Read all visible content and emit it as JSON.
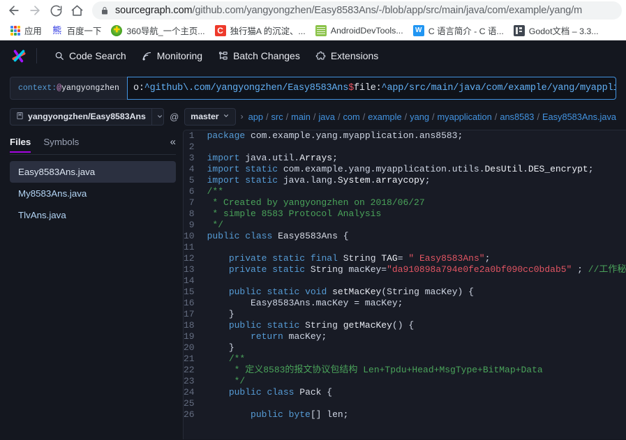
{
  "browser": {
    "nav": {
      "back_label": "Back",
      "forward_label": "Forward",
      "reload_label": "Reload",
      "home_label": "Home"
    },
    "omnibox": {
      "lock_icon": "lock-icon",
      "host": "sourcegraph.com",
      "path": "/github.com/yangyongzhen/Easy8583Ans/-/blob/app/src/main/java/com/example/yang/m"
    },
    "bookmarks": [
      {
        "label": "应用",
        "icon": "apps-grid-icon"
      },
      {
        "label": "百度一下",
        "icon": "baidu-icon"
      },
      {
        "label": "360导航_一个主页...",
        "icon": "360-nav-icon"
      },
      {
        "label": "独行猫A 的沉淀、...",
        "icon": "csdn-icon"
      },
      {
        "label": "AndroidDevTools...",
        "icon": "android-dev-tools-icon"
      },
      {
        "label": "C 语言简介 - C 语...",
        "icon": "w3c-icon"
      },
      {
        "label": "Godot文档 – 3.3...",
        "icon": "godot-icon"
      }
    ]
  },
  "sourcegraph": {
    "logo_icon": "sourcegraph-logo-icon",
    "nav_items": [
      {
        "label": "Code Search",
        "icon": "search-icon"
      },
      {
        "label": "Monitoring",
        "icon": "monitoring-icon"
      },
      {
        "label": "Batch Changes",
        "icon": "batch-changes-icon"
      },
      {
        "label": "Extensions",
        "icon": "puzzle-icon"
      }
    ],
    "search": {
      "context_prefix": "context:",
      "context_at": "@",
      "context_value": "yangyongzhen",
      "query_parts": [
        {
          "text": "o:",
          "color": "white"
        },
        {
          "text": "^github\\.com/yangyongzhen/Easy8583Ans",
          "color": "blue"
        },
        {
          "text": "$",
          "color": "red"
        },
        {
          "text": " file:",
          "color": "white"
        },
        {
          "text": "^app/src/main/java/com/example/yang/myapplicati",
          "color": "blue"
        }
      ]
    },
    "breadcrumb": {
      "repo_icon": "repository-icon",
      "repo": "yangyongzhen/Easy8583Ans",
      "repo_caret_icon": "chevron-down-icon",
      "at": "@",
      "revision": "master",
      "revision_caret_icon": "chevron-down-icon",
      "lead_chevron": "›",
      "path_parts": [
        "app",
        "src",
        "main",
        "java",
        "com",
        "example",
        "yang",
        "myapplication",
        "ans8583",
        "Easy8583Ans.java"
      ]
    },
    "sidebar": {
      "tabs": [
        {
          "label": "Files",
          "active": true
        },
        {
          "label": "Symbols",
          "active": false
        }
      ],
      "collapse_icon": "chevron-double-left-icon",
      "collapse_glyph": "«",
      "files": [
        {
          "name": "Easy8583Ans.java",
          "active": true
        },
        {
          "name": "My8583Ans.java",
          "active": false
        },
        {
          "name": "TlvAns.java",
          "active": false
        }
      ]
    },
    "code": {
      "language": "java",
      "lines": [
        {
          "n": 1,
          "tokens": [
            {
              "t": "package",
              "c": "kw"
            },
            {
              "t": " com.example.yang.myapplication.ans8583;",
              "c": "plain"
            }
          ]
        },
        {
          "n": 2,
          "tokens": []
        },
        {
          "n": 3,
          "tokens": [
            {
              "t": "import",
              "c": "kw"
            },
            {
              "t": " java.util.",
              "c": "plain"
            },
            {
              "t": "Arrays",
              "c": "prop"
            },
            {
              "t": ";",
              "c": "plain"
            }
          ]
        },
        {
          "n": 4,
          "tokens": [
            {
              "t": "import",
              "c": "kw"
            },
            {
              "t": " ",
              "c": "plain"
            },
            {
              "t": "static",
              "c": "kw"
            },
            {
              "t": " com.example.yang.myapplication.utils.",
              "c": "plain"
            },
            {
              "t": "DesUtil",
              "c": "prop"
            },
            {
              "t": ".",
              "c": "plain"
            },
            {
              "t": "DES_encrypt",
              "c": "prop"
            },
            {
              "t": ";",
              "c": "plain"
            }
          ]
        },
        {
          "n": 5,
          "tokens": [
            {
              "t": "import",
              "c": "kw"
            },
            {
              "t": " ",
              "c": "plain"
            },
            {
              "t": "static",
              "c": "kw"
            },
            {
              "t": " java.lang.",
              "c": "plain"
            },
            {
              "t": "System",
              "c": "prop"
            },
            {
              "t": ".",
              "c": "plain"
            },
            {
              "t": "arraycopy",
              "c": "prop"
            },
            {
              "t": ";",
              "c": "plain"
            }
          ]
        },
        {
          "n": 6,
          "tokens": [
            {
              "t": "/**",
              "c": "cmt"
            }
          ]
        },
        {
          "n": 7,
          "tokens": [
            {
              "t": " * Created by yangyongzhen on 2018/06/27",
              "c": "cmt"
            }
          ]
        },
        {
          "n": 8,
          "tokens": [
            {
              "t": " * simple 8583 Protocol Analysis",
              "c": "cmt"
            }
          ]
        },
        {
          "n": 9,
          "tokens": [
            {
              "t": " */",
              "c": "cmt"
            }
          ]
        },
        {
          "n": 10,
          "tokens": [
            {
              "t": "public",
              "c": "kw"
            },
            {
              "t": " ",
              "c": "plain"
            },
            {
              "t": "class",
              "c": "kw"
            },
            {
              "t": " ",
              "c": "plain"
            },
            {
              "t": "Easy8583Ans",
              "c": "type"
            },
            {
              "t": " {",
              "c": "plain"
            }
          ]
        },
        {
          "n": 11,
          "tokens": []
        },
        {
          "n": 12,
          "tokens": [
            {
              "t": "    ",
              "c": "plain"
            },
            {
              "t": "private",
              "c": "kw"
            },
            {
              "t": " ",
              "c": "plain"
            },
            {
              "t": "static",
              "c": "kw"
            },
            {
              "t": " ",
              "c": "plain"
            },
            {
              "t": "final",
              "c": "kw"
            },
            {
              "t": " ",
              "c": "plain"
            },
            {
              "t": "String",
              "c": "type"
            },
            {
              "t": " ",
              "c": "plain"
            },
            {
              "t": "TAG",
              "c": "prop"
            },
            {
              "t": "= ",
              "c": "plain"
            },
            {
              "t": "\" Easy8583Ans\"",
              "c": "str"
            },
            {
              "t": ";",
              "c": "plain"
            }
          ]
        },
        {
          "n": 13,
          "tokens": [
            {
              "t": "    ",
              "c": "plain"
            },
            {
              "t": "private",
              "c": "kw"
            },
            {
              "t": " ",
              "c": "plain"
            },
            {
              "t": "static",
              "c": "kw"
            },
            {
              "t": " ",
              "c": "plain"
            },
            {
              "t": "String",
              "c": "type"
            },
            {
              "t": " macKey=",
              "c": "plain"
            },
            {
              "t": "\"da910898a794e0fe2a0bf090cc0bdab5\"",
              "c": "str"
            },
            {
              "t": " ; ",
              "c": "plain"
            },
            {
              "t": "//工作秘钥",
              "c": "cmt"
            }
          ]
        },
        {
          "n": 14,
          "tokens": []
        },
        {
          "n": 15,
          "tokens": [
            {
              "t": "    ",
              "c": "plain"
            },
            {
              "t": "public",
              "c": "kw"
            },
            {
              "t": " ",
              "c": "plain"
            },
            {
              "t": "static",
              "c": "kw"
            },
            {
              "t": " ",
              "c": "plain"
            },
            {
              "t": "void",
              "c": "kw"
            },
            {
              "t": " ",
              "c": "plain"
            },
            {
              "t": "setMacKey",
              "c": "fn"
            },
            {
              "t": "(",
              "c": "plain"
            },
            {
              "t": "String",
              "c": "type"
            },
            {
              "t": " macKey) {",
              "c": "plain"
            }
          ]
        },
        {
          "n": 16,
          "tokens": [
            {
              "t": "        ",
              "c": "plain"
            },
            {
              "t": "Easy8583Ans",
              "c": "plain"
            },
            {
              "t": ".macKey = macKey;",
              "c": "plain"
            }
          ]
        },
        {
          "n": 17,
          "tokens": [
            {
              "t": "    }",
              "c": "plain"
            }
          ]
        },
        {
          "n": 18,
          "tokens": [
            {
              "t": "    ",
              "c": "plain"
            },
            {
              "t": "public",
              "c": "kw"
            },
            {
              "t": " ",
              "c": "plain"
            },
            {
              "t": "static",
              "c": "kw"
            },
            {
              "t": " ",
              "c": "plain"
            },
            {
              "t": "String",
              "c": "type"
            },
            {
              "t": " ",
              "c": "plain"
            },
            {
              "t": "getMacKey",
              "c": "fn"
            },
            {
              "t": "() {",
              "c": "plain"
            }
          ]
        },
        {
          "n": 19,
          "tokens": [
            {
              "t": "        ",
              "c": "plain"
            },
            {
              "t": "return",
              "c": "kw"
            },
            {
              "t": " macKey;",
              "c": "plain"
            }
          ]
        },
        {
          "n": 20,
          "tokens": [
            {
              "t": "    }",
              "c": "plain"
            }
          ]
        },
        {
          "n": 21,
          "tokens": [
            {
              "t": "    /**",
              "c": "cmt"
            }
          ]
        },
        {
          "n": 22,
          "tokens": [
            {
              "t": "     * 定义8583的报文协议包结构 Len+Tpdu+Head+MsgType+BitMap+Data",
              "c": "cmt"
            }
          ]
        },
        {
          "n": 23,
          "tokens": [
            {
              "t": "     */",
              "c": "cmt"
            }
          ]
        },
        {
          "n": 24,
          "tokens": [
            {
              "t": "    ",
              "c": "plain"
            },
            {
              "t": "public",
              "c": "kw"
            },
            {
              "t": " ",
              "c": "plain"
            },
            {
              "t": "class",
              "c": "kw"
            },
            {
              "t": " ",
              "c": "plain"
            },
            {
              "t": "Pack",
              "c": "type"
            },
            {
              "t": " {",
              "c": "plain"
            }
          ]
        },
        {
          "n": 25,
          "tokens": []
        },
        {
          "n": 26,
          "tokens": [
            {
              "t": "        ",
              "c": "plain"
            },
            {
              "t": "public",
              "c": "kw"
            },
            {
              "t": " ",
              "c": "plain"
            },
            {
              "t": "byte",
              "c": "kw"
            },
            {
              "t": "[] len;",
              "c": "plain"
            }
          ]
        }
      ]
    }
  },
  "colors": {
    "app_bg": "#14171f",
    "code_bg": "#181b25",
    "accent": "#a305e1",
    "link": "#4393e0",
    "focus_border": "#4393e0"
  }
}
